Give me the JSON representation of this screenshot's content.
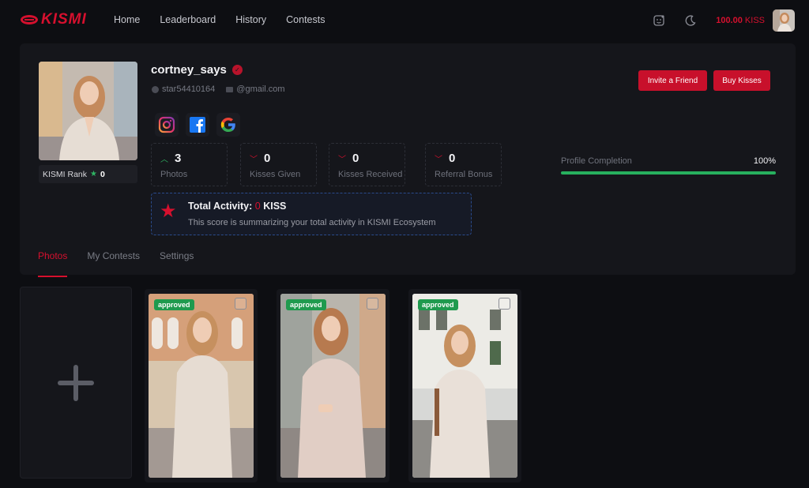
{
  "brand": {
    "name": "KISMI",
    "accent": "#d6102e"
  },
  "nav": {
    "items": [
      "Home",
      "Leaderboard",
      "History",
      "Contests"
    ]
  },
  "header": {
    "balance_value": "100.00",
    "balance_unit": "KISS",
    "icons": [
      "sticker-icon",
      "moon-icon"
    ]
  },
  "profile": {
    "username": "cortney_says",
    "user_id": "star54410164",
    "email": "@gmail.com",
    "rank_label": "KISMI Rank",
    "rank_value": "0",
    "socials": [
      "instagram-icon",
      "facebook-icon",
      "google-icon"
    ]
  },
  "stats": [
    {
      "value": "3",
      "label": "Photos",
      "trend": "up"
    },
    {
      "value": "0",
      "label": "Kisses Given",
      "trend": "down"
    },
    {
      "value": "0",
      "label": "Kisses Received",
      "trend": "down"
    },
    {
      "value": "0",
      "label": "Referral Bonus",
      "trend": "down"
    }
  ],
  "activity": {
    "label": "Total Activity:",
    "value": "0",
    "unit": "KISS",
    "description": "This score is summarizing your total activity in KISMI Ecosystem"
  },
  "actions": {
    "invite_label": "Invite a Friend",
    "buy_label": "Buy Kisses"
  },
  "completion": {
    "label": "Profile Completion",
    "value_text": "100%",
    "value": 1.0
  },
  "tabs": [
    {
      "label": "Photos",
      "active": true
    },
    {
      "label": "My Contests",
      "active": false
    },
    {
      "label": "Settings",
      "active": false
    }
  ],
  "photos": [
    {
      "status": "approved"
    },
    {
      "status": "approved"
    },
    {
      "status": "approved"
    }
  ]
}
